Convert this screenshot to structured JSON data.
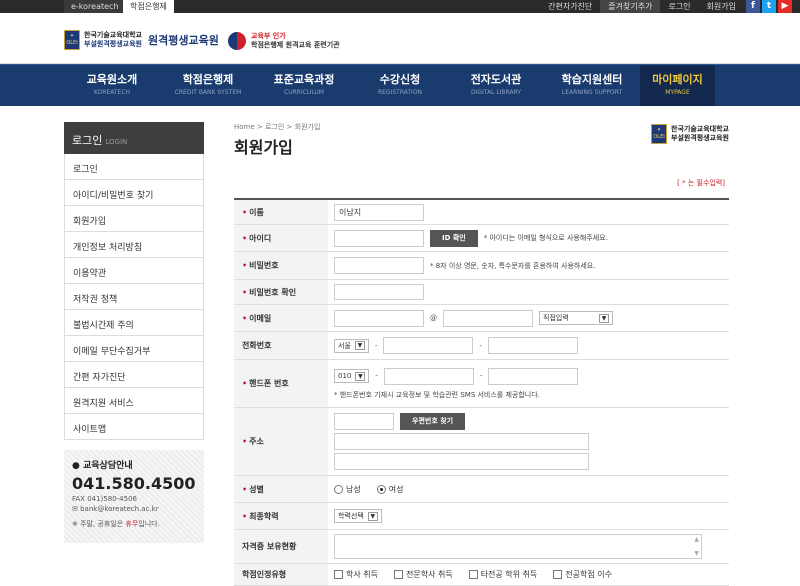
{
  "topbar": {
    "tab1": "e-koreatech",
    "tab2": "학점은행제",
    "links": [
      "간편자가진단",
      "즐겨찾기추가",
      "로그인",
      "회원가입"
    ],
    "social": [
      "f",
      "t",
      "▶"
    ]
  },
  "header": {
    "logo1_line1": "한국기술교육대학교",
    "logo1_line2": "부설원격평생교육원",
    "logo1_big": "원격평생교육원",
    "logo2_line1": "교육부 인가",
    "logo2_line2": "학점은행제 원격교육 훈련기관"
  },
  "nav": [
    {
      "k": "교육원소개",
      "e": "KOREATECH"
    },
    {
      "k": "학점은행제",
      "e": "CREDIT BANK SYSTEM"
    },
    {
      "k": "표준교육과정",
      "e": "CURRICULUM"
    },
    {
      "k": "수강신청",
      "e": "REGISTRATION"
    },
    {
      "k": "전자도서관",
      "e": "DIGITAL LIBRARY"
    },
    {
      "k": "학습지원센터",
      "e": "LEARNING SUPPORT"
    },
    {
      "k": "마이페이지",
      "e": "MYPAGE"
    }
  ],
  "sidebar": {
    "title": "로그인",
    "title_en": "LOGIN",
    "items": [
      "로그인",
      "아이디/비밀번호 찾기",
      "회원가입",
      "개인정보 처리방침",
      "이용약관",
      "저작권 정책",
      "불법시간제 주의",
      "이메일 무단수집거부",
      "간편 자가진단",
      "원격지원 서비스",
      "사이트맵"
    ]
  },
  "contact": {
    "title": "교육상담안내",
    "phone": "041.580.4500",
    "fax": "FAX 041)580-4506",
    "email": "bank@koreatech.ac.kr",
    "note_pre": "※ 주말, 공휴일은 ",
    "note_em": "휴무",
    "note_post": "입니다."
  },
  "main": {
    "breadcrumb": "Home > 로그인 > 회원가입",
    "title": "회원가입",
    "logo_line1": "한국기술교육대학교",
    "logo_line2": "부설원격평생교육원",
    "required_note": "[ * 는 필수입력]"
  },
  "form": {
    "name_label": "이름",
    "name_value": "이남지",
    "id_label": "아이디",
    "id_btn": "ID 확인",
    "id_hint": "* 아이디는 이메일 형식으로 사용해주세요.",
    "pw_label": "비밀번호",
    "pw_hint": "* 8자 이상 영문, 숫자, 특수문자를 혼용하여 사용하세요.",
    "pw2_label": "비밀번호 확인",
    "email_label": "이메일",
    "email_at": "@",
    "email_select": "직접입력",
    "tel_label": "전화번호",
    "tel_area": "서울",
    "dash": "-",
    "mobile_label": "핸드폰 번호",
    "mobile_prefix": "010",
    "mobile_hint": "* 핸드폰번호 기재시 교육정보 및 학습관련 SMS 서비스를 제공합니다.",
    "addr_label": "주소",
    "addr_btn": "우편번호 찾기",
    "gender_label": "성별",
    "gender_male": "남성",
    "gender_female": "여성",
    "edu_label": "최종학력",
    "edu_select": "학력선택",
    "cert_label": "자격증 보유현황",
    "extra_label": "학점인정유형",
    "extra_opts": [
      "학사 취득",
      "전문학사 취득",
      "타전공 학위 취득",
      "전공학점 이수"
    ]
  },
  "colors": {
    "nav_bg": "#1a3b6e",
    "accent": "#d0202a",
    "mypage": "#f3c93a"
  }
}
